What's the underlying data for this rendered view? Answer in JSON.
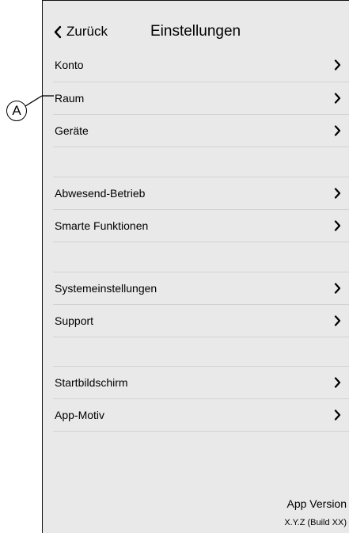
{
  "header": {
    "back_label": "Zurück",
    "title": "Einstellungen"
  },
  "menu": {
    "groups": [
      {
        "items": [
          {
            "label": "Konto"
          },
          {
            "label": "Raum"
          },
          {
            "label": "Geräte"
          }
        ]
      },
      {
        "items": [
          {
            "label": "Abwesend-Betrieb"
          },
          {
            "label": "Smarte Funktionen"
          }
        ]
      },
      {
        "items": [
          {
            "label": "Systemeinstellungen"
          },
          {
            "label": "Support"
          }
        ]
      },
      {
        "items": [
          {
            "label": "Startbildschirm"
          },
          {
            "label": "App-Motiv"
          }
        ]
      }
    ]
  },
  "footer": {
    "version_label": "App Version",
    "version_value": "X.Y.Z (Build XX)"
  },
  "annotation": {
    "callout_letter": "A"
  },
  "icons": {
    "back": "chevron-left-icon",
    "row": "chevron-right-icon"
  },
  "colors": {
    "background": "#e9e9e9",
    "divider": "#d2d2d2"
  }
}
